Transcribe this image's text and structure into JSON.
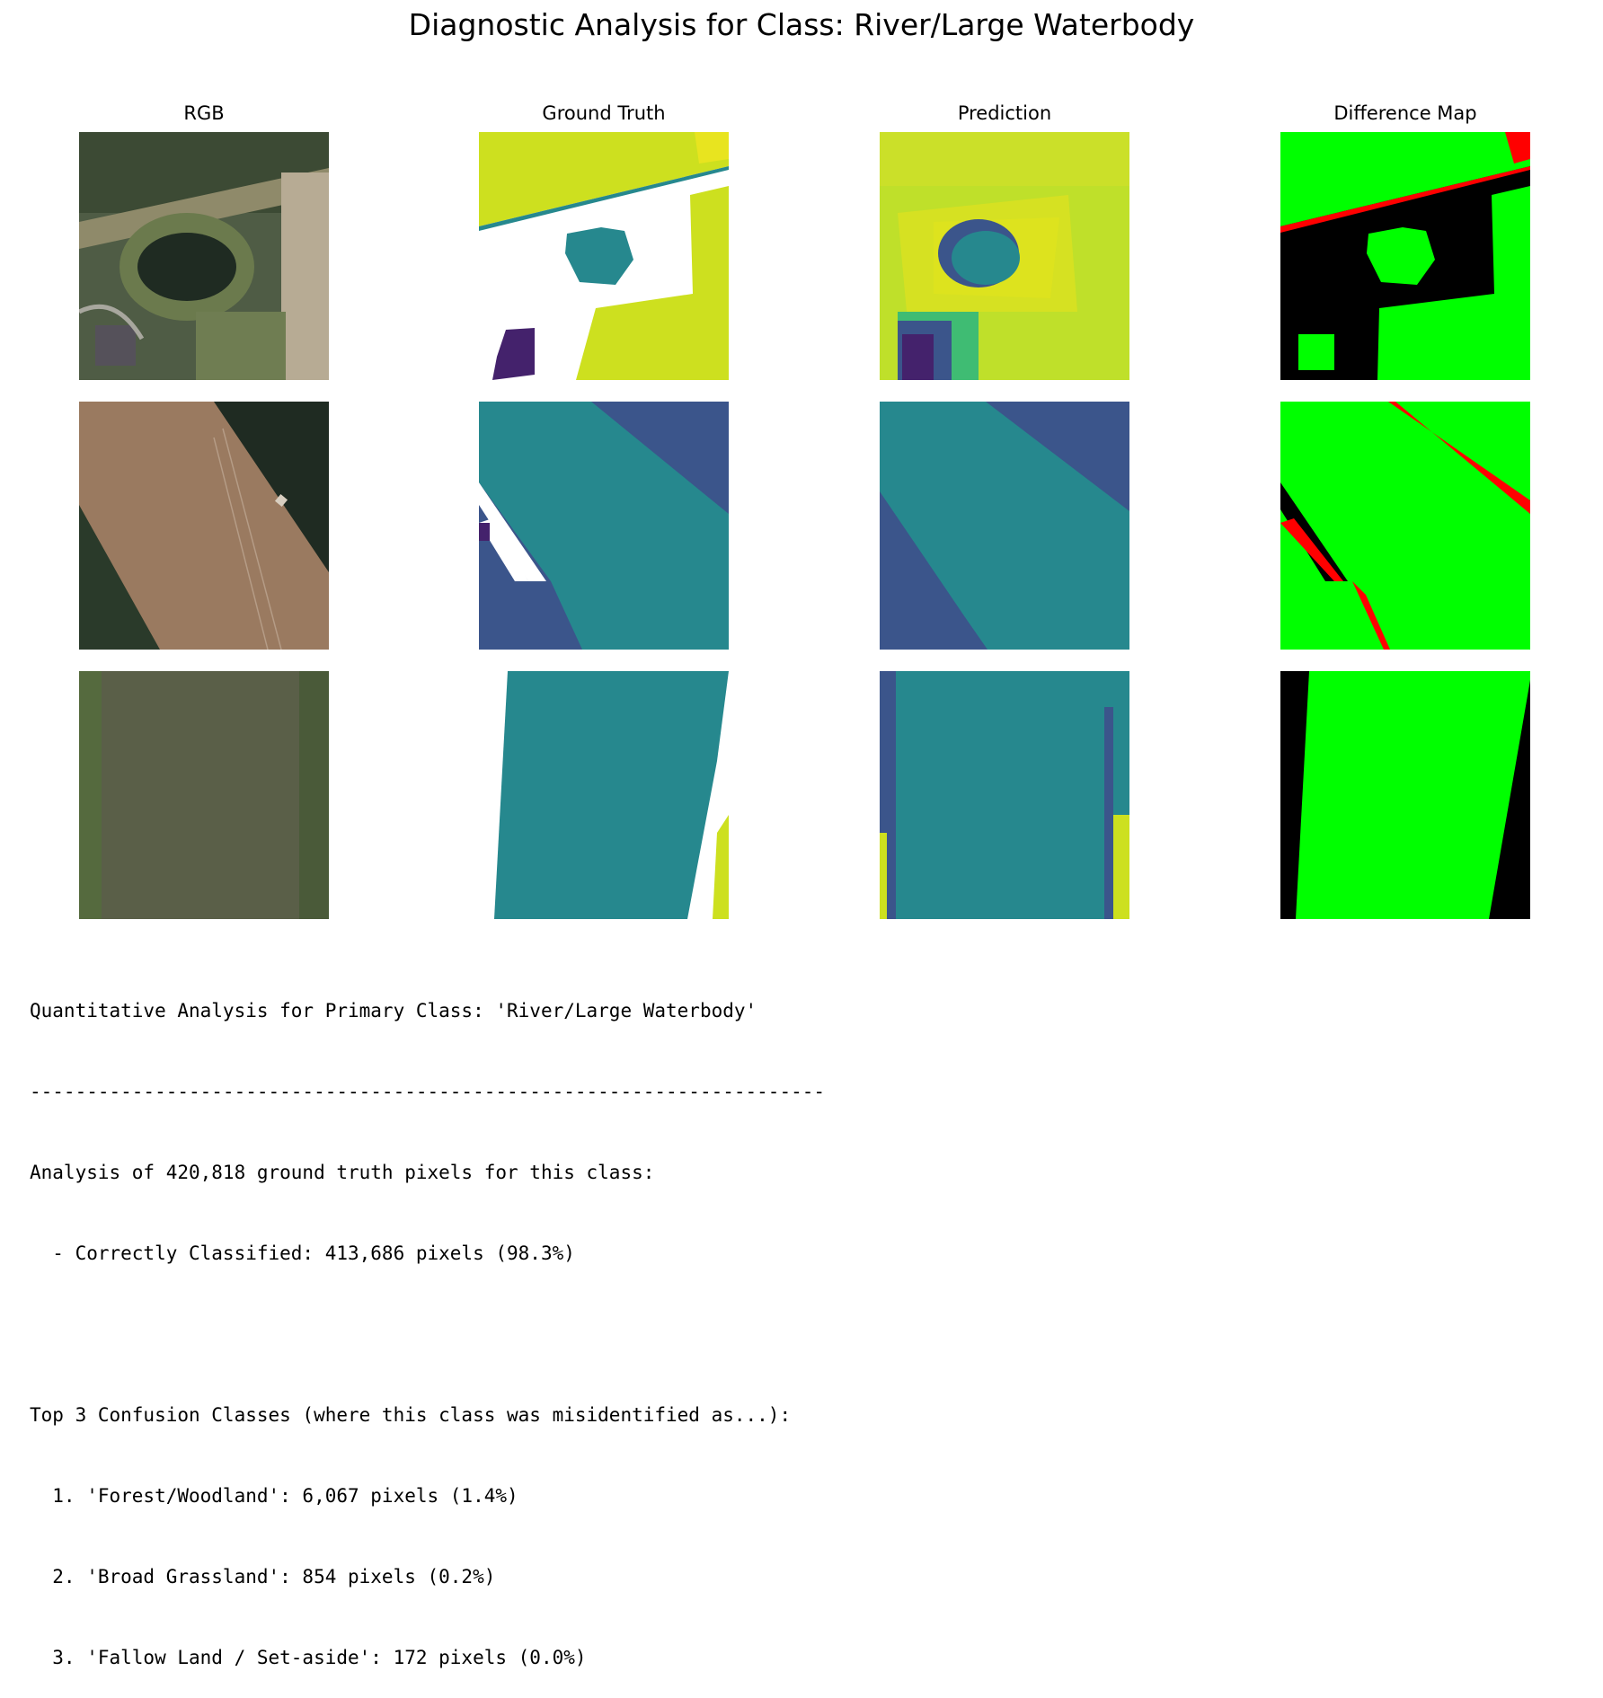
{
  "figure": {
    "title": "Diagnostic Analysis for Class: River/Large Waterbody",
    "columns": [
      "RGB",
      "Ground Truth",
      "Prediction",
      "Difference Map"
    ]
  },
  "colors": {
    "water_teal": "#26888e",
    "dark_blue": "#3b558b",
    "purple": "#44226c",
    "yellow_green": "#cde01f",
    "yellow": "#e8e41f",
    "lime": "#00ff00",
    "red": "#ff0000",
    "black": "#000000"
  },
  "report": {
    "heading": "Quantitative Analysis for Primary Class: 'River/Large Waterbody'",
    "divider": "----------------------------------------------------------------------",
    "summary": "Analysis of 420,818 ground truth pixels for this class:",
    "correct": "  - Correctly Classified: 413,686 pixels (98.3%)",
    "confusion_heading": "Top 3 Confusion Classes (where this class was misidentified as...):",
    "confusions": [
      "  1. 'Forest/Woodland': 6,067 pixels (1.4%)",
      "  2. 'Broad Grassland': 854 pixels (0.2%)",
      "  3. 'Fallow Land / Set-aside': 172 pixels (0.0%)"
    ]
  }
}
